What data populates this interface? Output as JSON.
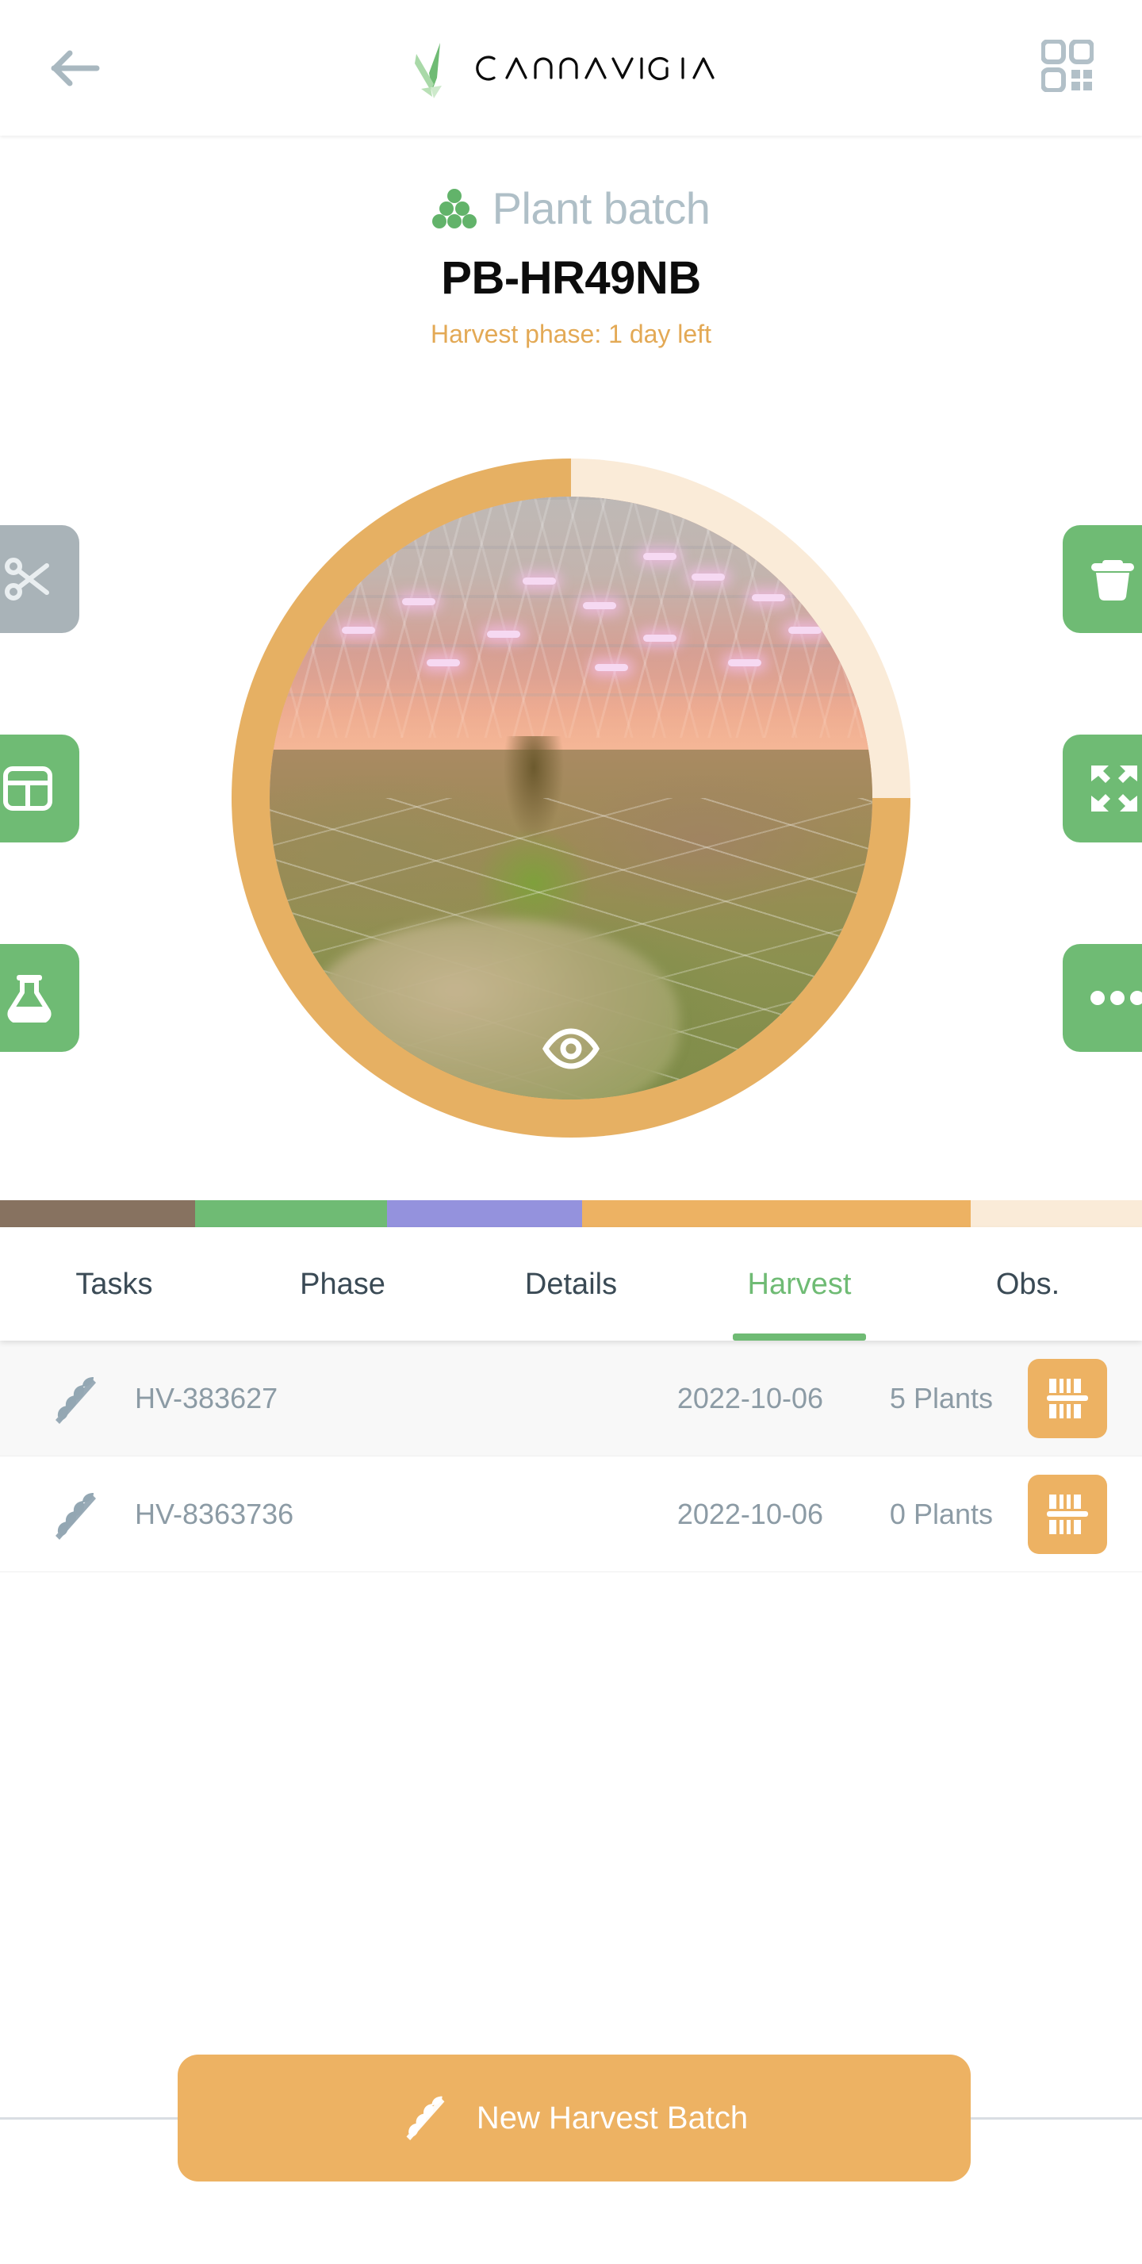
{
  "header": {
    "back_icon": "arrow-left-icon",
    "brand_name": "CANNAVIGIA",
    "qr_icon": "qr-code-scan-icon"
  },
  "batch": {
    "type_label": "Plant batch",
    "type_icon": "plant-dots-icon",
    "id": "PB-HR49NB",
    "phase_status": "Harvest phase: 1 day left",
    "image_icon": "eye-icon",
    "ring_progress_percent": 75,
    "ring_color": "#E6B063",
    "ring_track_color": "#FAEBD8"
  },
  "side_actions": {
    "left": [
      {
        "name": "harvest-scissors-button",
        "icon": "scissors-icon",
        "enabled": false,
        "color": "#A9B3B8"
      },
      {
        "name": "table-view-button",
        "icon": "table-icon",
        "enabled": true,
        "color": "#6FBB74"
      },
      {
        "name": "lab-test-button",
        "icon": "flask-icon",
        "enabled": true,
        "color": "#6FBB74"
      }
    ],
    "right": [
      {
        "name": "destroy-button",
        "icon": "trash-icon",
        "enabled": true,
        "color": "#6FBB74"
      },
      {
        "name": "move-button",
        "icon": "expand-arrows-icon",
        "enabled": true,
        "color": "#6FBB74"
      },
      {
        "name": "more-options-button",
        "icon": "ellipsis-icon",
        "enabled": true,
        "color": "#6FBB74"
      }
    ]
  },
  "phase_bar": {
    "segments": [
      {
        "name": "seedling",
        "color": "#877260",
        "width_pct": 17.1
      },
      {
        "name": "vegetative",
        "color": "#6FBB74",
        "width_pct": 16.8
      },
      {
        "name": "flowering",
        "color": "#9492DD",
        "width_pct": 17.1
      },
      {
        "name": "harvest",
        "color": "#EDB263",
        "width_pct": 34.0
      },
      {
        "name": "remaining",
        "color": "#FAEBD8",
        "width_pct": 15.0
      }
    ]
  },
  "tabs": {
    "active_index": 3,
    "items": [
      {
        "label": "Tasks",
        "name": "tab-tasks"
      },
      {
        "label": "Phase",
        "name": "tab-phase"
      },
      {
        "label": "Details",
        "name": "tab-details"
      },
      {
        "label": "Harvest",
        "name": "tab-harvest"
      },
      {
        "label": "Obs.",
        "name": "tab-obs"
      }
    ],
    "active_color": "#6FBB74",
    "inactive_color": "#3A4A55"
  },
  "harvest_list": {
    "rows": [
      {
        "icon": "wheat-icon",
        "code": "HV-383627",
        "date": "2022-10-06",
        "count": "5 Plants",
        "action_icon": "barcode-icon"
      },
      {
        "icon": "wheat-icon",
        "code": "HV-8363736",
        "date": "2022-10-06",
        "count": "0 Plants",
        "action_icon": "barcode-icon"
      }
    ]
  },
  "bottom": {
    "primary_button_label": "New Harvest Batch",
    "primary_button_icon": "wheat-icon",
    "primary_button_color": "#EDB263"
  }
}
